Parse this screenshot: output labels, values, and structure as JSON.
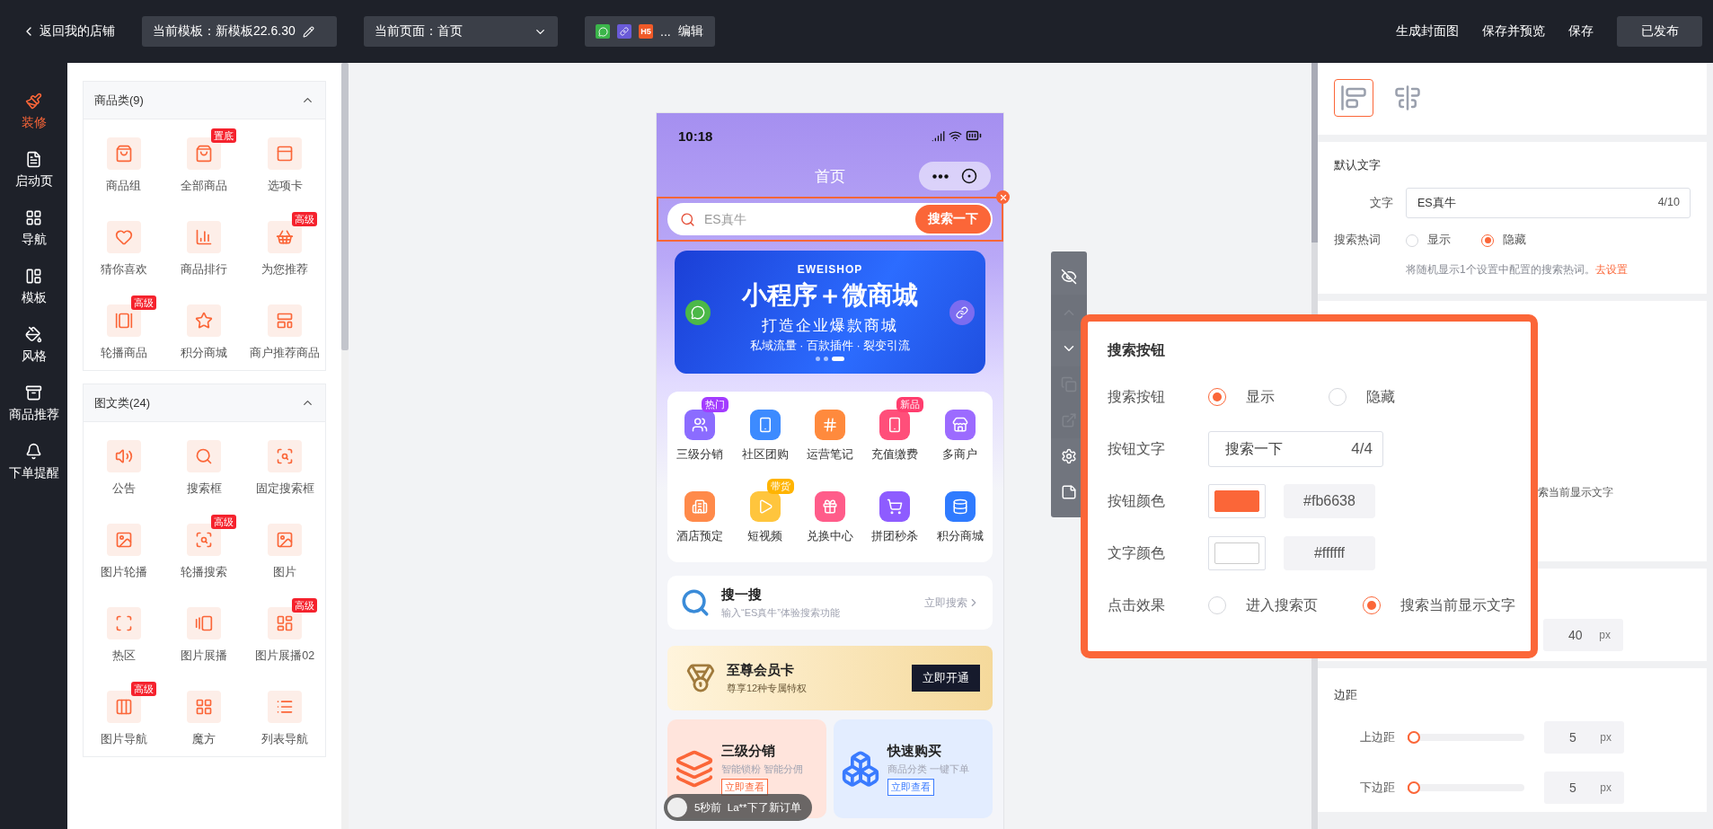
{
  "topbar": {
    "back": "返回我的店铺",
    "template": "当前模板：新模板22.6.30",
    "page": "当前页面：首页",
    "platform_badge": "H5",
    "platform_more": "...",
    "platform_edit": "编辑",
    "actions": [
      "生成封面图",
      "保存并预览",
      "保存"
    ],
    "publish": "已发布"
  },
  "nav": [
    {
      "label": "装修",
      "selected": true
    },
    {
      "label": "启动页",
      "selected": false
    },
    {
      "label": "导航",
      "selected": false
    },
    {
      "label": "模板",
      "selected": false
    },
    {
      "label": "风格",
      "selected": false
    },
    {
      "label": "商品推荐",
      "selected": false
    },
    {
      "label": "下单提醒",
      "selected": false
    }
  ],
  "categories": [
    {
      "title": "商品类(9)",
      "expanded": true,
      "items": [
        {
          "label": "商品组"
        },
        {
          "label": "全部商品",
          "badge": "置底"
        },
        {
          "label": "选项卡"
        },
        {
          "label": "猜你喜欢"
        },
        {
          "label": "商品排行"
        },
        {
          "label": "为您推荐",
          "badge": "高级"
        },
        {
          "label": "轮播商品",
          "badge": "高级"
        },
        {
          "label": "积分商城"
        },
        {
          "label": "商户推荐商品"
        }
      ]
    },
    {
      "title": "图文类(24)",
      "expanded": true,
      "items": [
        {
          "label": "公告"
        },
        {
          "label": "搜索框"
        },
        {
          "label": "固定搜索框"
        },
        {
          "label": "图片轮播"
        },
        {
          "label": "轮播搜索",
          "badge": "高级"
        },
        {
          "label": "图片"
        },
        {
          "label": "热区"
        },
        {
          "label": "图片展播"
        },
        {
          "label": "图片展播02",
          "badge": "高级"
        },
        {
          "label": "图片导航",
          "badge": "高级"
        },
        {
          "label": "魔方"
        },
        {
          "label": "列表导航"
        }
      ]
    }
  ],
  "phone": {
    "time": "10:18",
    "title": "首页",
    "search": {
      "placeholder": "ES真牛",
      "button": "搜索一下",
      "selected": true
    },
    "banner": {
      "brand": "EWEISHOP",
      "headline": "小程序＋微商城",
      "subtitle": "打造企业爆款商城",
      "tagline": "私域流量 · 百款插件 · 裂变引流"
    },
    "nav": [
      {
        "label": "三级分销",
        "badge": "热门"
      },
      {
        "label": "社区团购"
      },
      {
        "label": "运营笔记"
      },
      {
        "label": "充值缴费",
        "badge": "新品"
      },
      {
        "label": "多商户"
      },
      {
        "label": "酒店预定"
      },
      {
        "label": "短视频",
        "badge": "带货"
      },
      {
        "label": "兑换中心"
      },
      {
        "label": "拼团秒杀"
      },
      {
        "label": "积分商城"
      }
    ],
    "search_card": {
      "title": "搜一搜",
      "subtitle": "输入“ES真牛”体验搜索功能",
      "link": "立即搜索"
    },
    "member_card": {
      "title": "至尊会员卡",
      "subtitle": "尊享12种专属特权",
      "button": "立即开通"
    },
    "promo_cards": [
      {
        "title": "三级分销",
        "subtitle": "智能锁粉 智能分佣",
        "tag": "立即查看",
        "color": "#fb6638"
      },
      {
        "title": "快速购买",
        "subtitle": "商品分类 一键下单",
        "tag": "立即查看",
        "color": "#3a7bff"
      }
    ],
    "toast": "5秒前  La**下了新订单"
  },
  "tools": [
    {
      "disabled": false
    },
    {
      "disabled": true
    },
    {
      "disabled": false
    },
    {
      "disabled": true
    },
    {
      "disabled": true
    },
    {
      "disabled": false
    },
    {
      "disabled": false
    }
  ],
  "settings": {
    "align_tabs": [
      {
        "selected": true
      },
      {
        "selected": false
      }
    ],
    "default_text": {
      "title": "默认文字",
      "text_label": "文字",
      "text_value": "ES真牛",
      "text_count": "4/10",
      "hotword_label": "搜索热词",
      "hotword_options": [
        {
          "label": "显示",
          "selected": false
        },
        {
          "label": "隐藏",
          "selected": true
        }
      ],
      "hint": "将随机显示1个设置中配置的搜索热词。",
      "hint_link": "去设置"
    },
    "text_fragment": "索当前显示文字",
    "height_value": "40",
    "height_unit": "px",
    "margin": {
      "title": "边距",
      "rows": [
        {
          "label": "上边距",
          "level": 0.05,
          "value": "5",
          "unit": "px"
        },
        {
          "label": "下边距",
          "level": 0.05,
          "value": "5",
          "unit": "px"
        }
      ]
    }
  },
  "popup": {
    "title": "搜索按钮",
    "show_label": "搜索按钮",
    "show_options": [
      {
        "label": "显示",
        "selected": true
      },
      {
        "label": "隐藏",
        "selected": false
      }
    ],
    "text_label": "按钮文字",
    "text_value": "搜索一下",
    "text_count": "4/4",
    "button_color_label": "按钮颜色",
    "button_color": "#fb6638",
    "text_color_label": "文字颜色",
    "text_color": "#ffffff",
    "effect_label": "点击效果",
    "effect_options": [
      {
        "label": "进入搜索页",
        "selected": false
      },
      {
        "label": "搜索当前显示文字",
        "selected": true
      }
    ]
  }
}
